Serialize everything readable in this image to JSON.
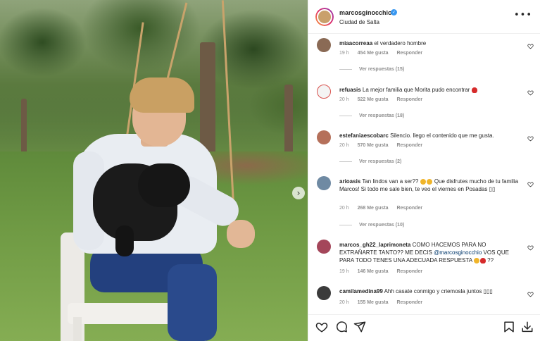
{
  "post": {
    "username": "marcosginocchio",
    "location": "Ciudad de Salta",
    "more_label": "•••",
    "carousel_next": "›"
  },
  "comments": [
    {
      "username": "miaacorreaa",
      "text": "el verdadero hombre",
      "time": "19 h",
      "likes": "454 Me gusta",
      "reply": "Responder",
      "replies": "Ver respuestas (15)",
      "avatar_color": "#8a6a55"
    },
    {
      "username": "refuasis",
      "text": "La mejor familia que Morita pudo encontrar",
      "time": "20 h",
      "likes": "522 Me gusta",
      "reply": "Responder",
      "replies": "Ver respuestas (18)",
      "avatar_color": "#f4f4f4"
    },
    {
      "username": "estefaniaescobarc",
      "text": "Silencio. llego el contenido que me gusta.",
      "time": "20 h",
      "likes": "570 Me gusta",
      "reply": "Responder",
      "replies": "Ver respuestas (2)",
      "avatar_color": "#b5705a"
    },
    {
      "username": "arioasis",
      "text_before": "Tan lindos van a ser??",
      "text_after": "Que disfrutes mucho de tu familia Marcos! Si todo me sale bien, te veo el viernes en Posadas ▯▯",
      "time": "20 h",
      "likes": "268 Me gusta",
      "reply": "Responder",
      "replies": "Ver respuestas (10)",
      "avatar_color": "#6f8aa3"
    },
    {
      "username": "marcos_gh22_laprimoneta",
      "text_before": "COMO HACEMOS PARA NO EXTRAÑARTE TANTO?? ME DECIS",
      "mention": "@marcosginocchio",
      "text_after": "VOS QUE PARA TODO TENES UNA ADECUADA RESPUESTA",
      "text_end": "??",
      "time": "19 h",
      "likes": "146 Me gusta",
      "reply": "Responder",
      "avatar_color": "#a4465a"
    },
    {
      "username": "camilamedina99",
      "text": "Ahh casate conmigo y criemosla juntos ▯▯▯",
      "time": "20 h",
      "likes": "155 Me gusta",
      "reply": "Responder",
      "avatar_color": "#3b3b3b"
    }
  ],
  "icons": {
    "like": "heart-icon",
    "comment": "comment-icon",
    "share": "share-icon",
    "save": "bookmark-icon",
    "download": "download-icon"
  },
  "colors": {
    "text": "#262626",
    "secondary": "#8e8e8e",
    "verified": "#3897f0",
    "mention": "#00376b"
  }
}
